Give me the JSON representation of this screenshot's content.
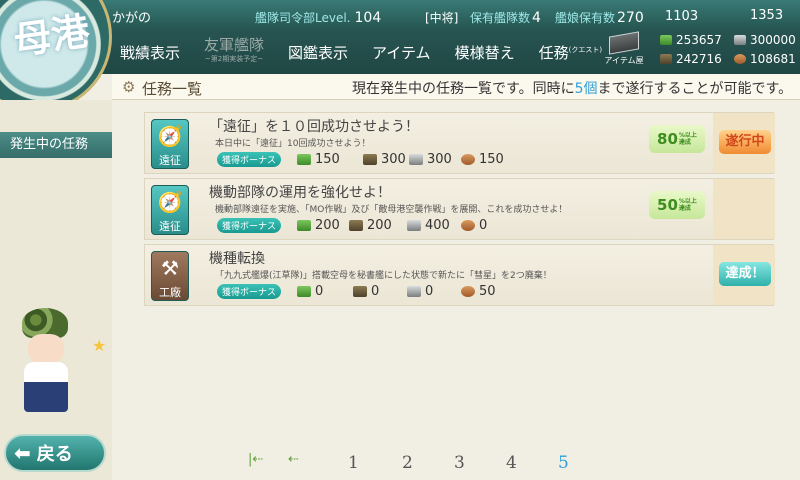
{
  "header": {
    "admiral_name": "かがの",
    "hq_level_label": "艦隊司令部Level.",
    "hq_level": "104",
    "rank": "[中将]",
    "fleet_count_label": "保有艦隊数",
    "fleet_count": "4",
    "ship_count_label": "艦娘保有数",
    "ship_count": "270",
    "buckets": "1103",
    "torches": "1353"
  },
  "nav": {
    "items": [
      {
        "label": "戦績表示"
      },
      {
        "label": "友軍艦隊",
        "sub": "~第2期実装予定~",
        "disabled": true
      },
      {
        "label": "図鑑表示"
      },
      {
        "label": "アイテム"
      },
      {
        "label": "模様替え"
      },
      {
        "label": "任務",
        "sup": "(クエスト)"
      }
    ],
    "item_shop_label": "アイテム屋"
  },
  "resources": {
    "fuel": "253657",
    "steel": "300000",
    "ammo": "242716",
    "bauxite": "108681"
  },
  "emblem_text": "母港",
  "title": {
    "label": "任務一覧",
    "notice_before": "現在発生中の任務一覧です。同時に",
    "notice_highlight": "5個",
    "notice_after": "まで遂行することが可能です。"
  },
  "sidebar": {
    "active_tab": "発生中の任務"
  },
  "quests": [
    {
      "category": "遠征",
      "category_icon": "compass-icon",
      "title": "「遠征」を１０回成功させよう！",
      "description": "本日中に「遠征」10回成功させよう！",
      "bonus_label": "獲得ボーナス",
      "rewards": {
        "fuel": "150",
        "ammo": "300",
        "steel": "300",
        "bauxite": "150"
      },
      "progress": "80",
      "progress_suffix_top": "%以上",
      "progress_suffix_bottom": "達成",
      "status": "遂行中"
    },
    {
      "category": "遠征",
      "category_icon": "compass-icon",
      "title": "機動部隊の運用を強化せよ！",
      "description": "機動部隊遠征を実施、「MO作戦」及び「敵母港空襲作戦」を展開、これを成功させよ！",
      "bonus_label": "獲得ボーナス",
      "rewards": {
        "fuel": "200",
        "ammo": "200",
        "steel": "400",
        "bauxite": "0"
      },
      "progress": "50",
      "progress_suffix_top": "%以上",
      "progress_suffix_bottom": "達成",
      "status": ""
    },
    {
      "category": "工廠",
      "category_icon": "hammer-icon",
      "title": "機種転換",
      "description": "「九九式艦爆(江草隊)」搭載空母を秘書艦にした状態で新たに「彗星」を2つ廃棄！",
      "bonus_label": "獲得ボーナス",
      "rewards": {
        "fuel": "0",
        "ammo": "0",
        "steel": "0",
        "bauxite": "50"
      },
      "progress": "",
      "status": "達成！"
    }
  ],
  "pager": {
    "pages": [
      "1",
      "2",
      "3",
      "4",
      "5"
    ],
    "current": "5"
  },
  "back_button": "戻る"
}
